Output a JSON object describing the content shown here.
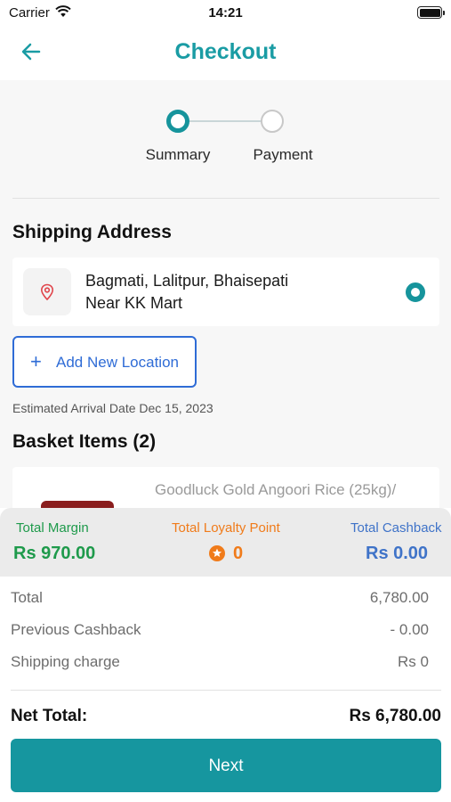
{
  "status_bar": {
    "carrier": "Carrier",
    "time": "14:21"
  },
  "header": {
    "title": "Checkout",
    "back_icon": "arrow-left-icon"
  },
  "stepper": {
    "steps": [
      {
        "label": "Summary",
        "state": "active"
      },
      {
        "label": "Payment",
        "state": "inactive"
      }
    ]
  },
  "shipping": {
    "title": "Shipping Address",
    "address": {
      "line1": "Bagmati, Lalitpur, Bhaisepati",
      "line2": "Near KK Mart",
      "selected": true
    },
    "add_button": {
      "icon": "plus-icon",
      "label": "Add New Location"
    },
    "arrival_text": "Estimated Arrival Date Dec 15, 2023"
  },
  "basket": {
    "title": "Basket Items (2)",
    "items": [
      {
        "name": "Goodluck Gold Angoori Rice (25kg)/"
      }
    ]
  },
  "summary_strip": {
    "margin": {
      "label": "Total Margin",
      "value": "Rs 970.00"
    },
    "loyalty": {
      "label": "Total Loyalty Point",
      "value": "0"
    },
    "cashback": {
      "label": "Total Cashback",
      "value": "Rs 0.00"
    }
  },
  "totals": {
    "rows": [
      {
        "label": "Total",
        "value": "6,780.00"
      },
      {
        "label": "Previous Cashback",
        "value": "- 0.00"
      },
      {
        "label": "Shipping charge",
        "value": "Rs 0"
      }
    ],
    "net_label": "Net Total:",
    "net_value": "Rs 6,780.00"
  },
  "next_button": {
    "label": "Next"
  },
  "colors": {
    "accent": "#16949c",
    "margin_green": "#1e9a4b",
    "loyalty_orange": "#f07b1a",
    "cashback_blue": "#3f73c8",
    "link_blue": "#2f6cd6"
  }
}
